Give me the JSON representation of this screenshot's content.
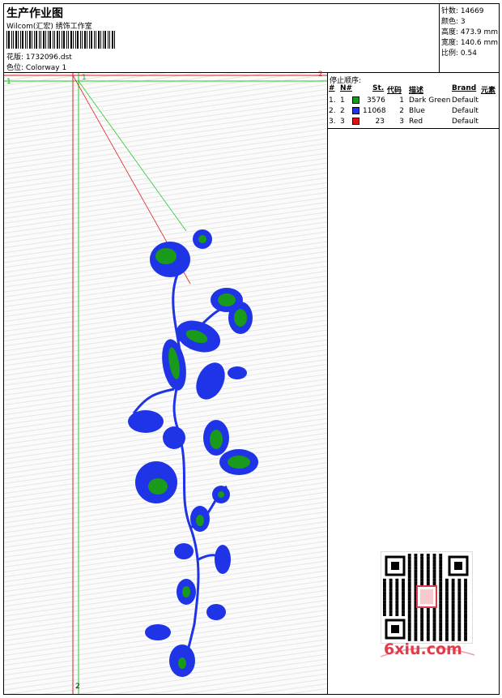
{
  "header": {
    "title": "生产作业图",
    "company": "Wilcom(汇宏) 绣饰工作室",
    "design_label": "花版:",
    "design_value": "1732096.dst",
    "colorway_label": "色位:",
    "colorway_value": "Colorway 1"
  },
  "stats": {
    "stitches": "针数: 14669",
    "colors": "颜色: 3",
    "height": "高度: 473.9 mm",
    "width": "宽度: 140.6 mm",
    "scale": "比例: 0.54"
  },
  "stop_sequence": {
    "title": "停止顺序:",
    "columns": {
      "no": "#",
      "n": "N#",
      "st": "St.",
      "code": "代码",
      "desc": "描述",
      "brand": "Brand",
      "elem": "元素"
    },
    "rows": [
      {
        "no": "1.",
        "n": "1",
        "color": "#1a9a1a",
        "st": "3576",
        "code": "1",
        "desc": "Dark Green",
        "brand": "Default"
      },
      {
        "no": "2.",
        "n": "2",
        "color": "#1f34e6",
        "st": "11068",
        "code": "2",
        "desc": "Blue",
        "brand": "Default"
      },
      {
        "no": "3.",
        "n": "3",
        "color": "#e01010",
        "st": "23",
        "code": "3",
        "desc": "Red",
        "brand": "Default"
      }
    ]
  },
  "guides": {
    "label1": "1",
    "label1b": "1",
    "label2": "2",
    "label2b": "2"
  },
  "watermark": "6xiu.com",
  "colors": {
    "dark_green": "#1a9a1a",
    "blue": "#1f34e6",
    "red": "#e01010",
    "guide_green": "#22cc22",
    "guide_red": "#dd2222"
  }
}
